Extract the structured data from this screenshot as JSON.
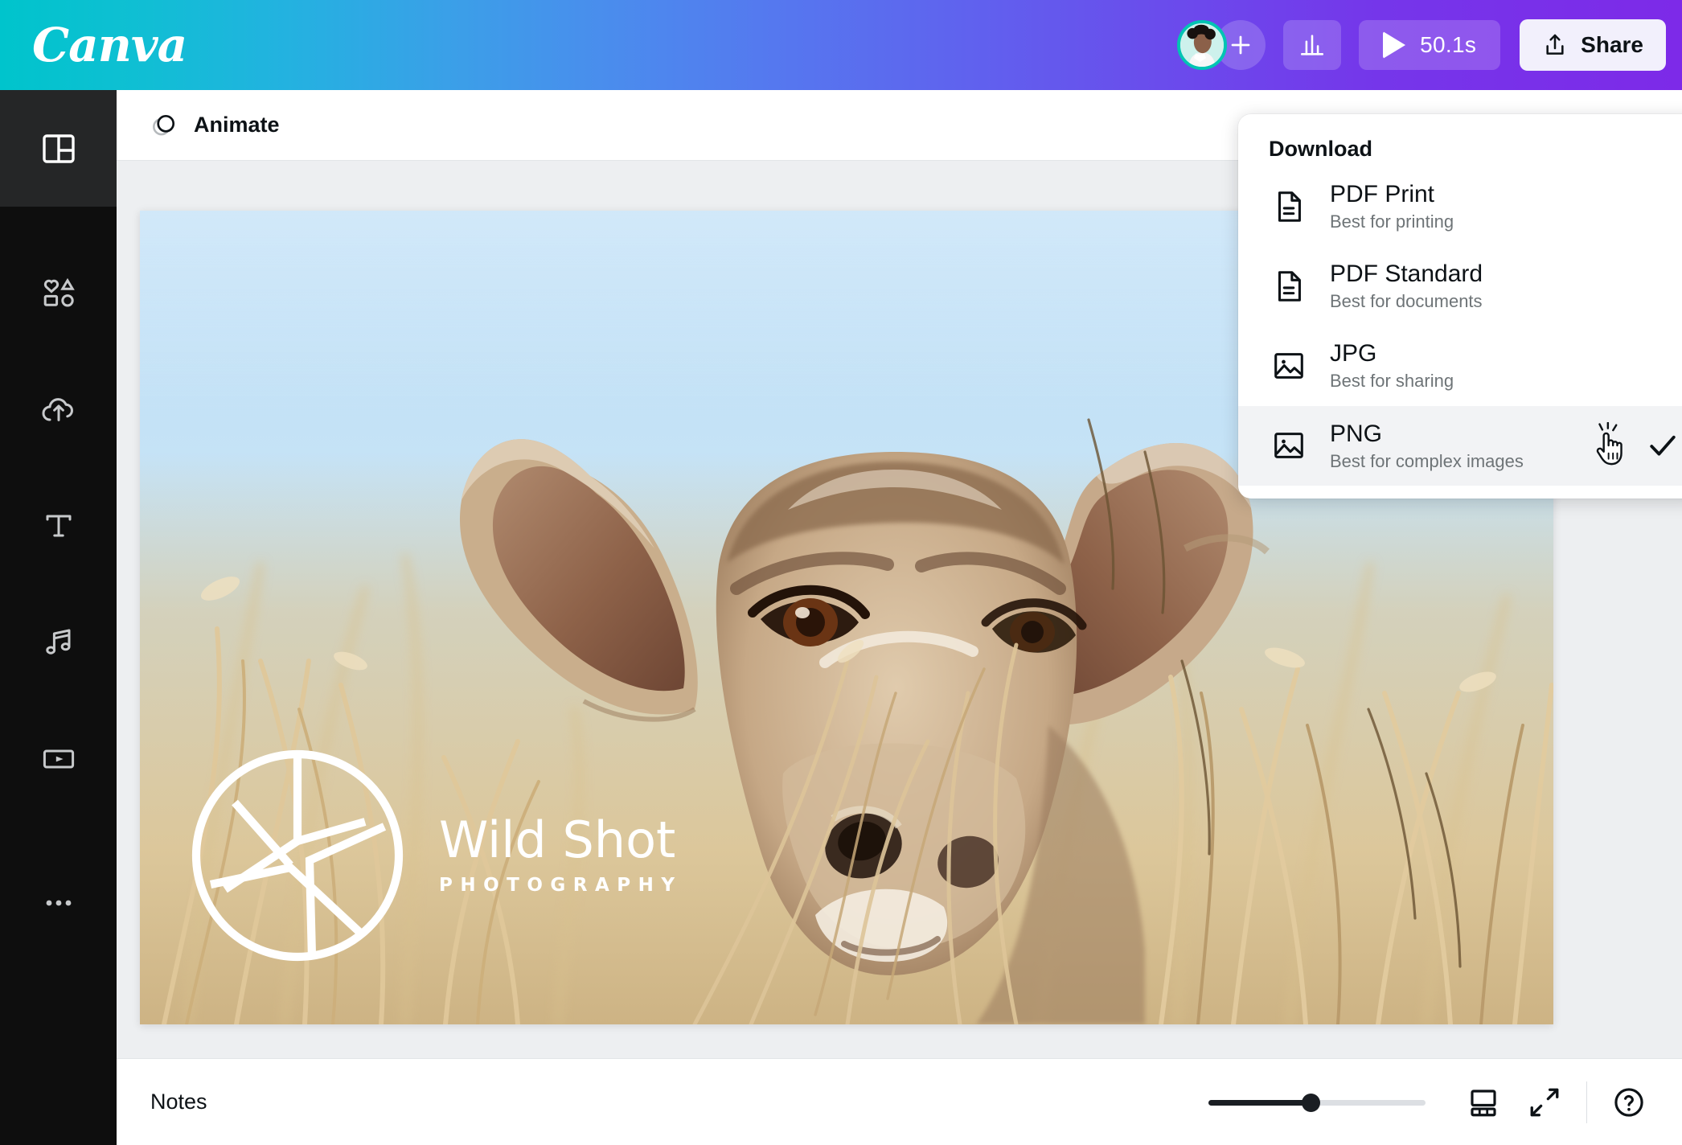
{
  "app": {
    "brand": "Canva",
    "brand_gradient_start": "#00c4cc",
    "brand_gradient_end": "#7d2ae8"
  },
  "topbar": {
    "avatar_name": "user-avatar",
    "avatar_ring_color": "#00c4b3",
    "add_collaborator_label": "+",
    "insights_icon": "bar-chart-icon",
    "play_label": "50.1s",
    "share_label": "Share"
  },
  "sidebar": {
    "items": [
      {
        "name": "design",
        "icon": "layout-panels-icon",
        "active": true
      },
      {
        "name": "elements",
        "icon": "shapes-icon",
        "active": false
      },
      {
        "name": "uploads",
        "icon": "cloud-upload-icon",
        "active": false
      },
      {
        "name": "text",
        "icon": "text-t-icon",
        "active": false
      },
      {
        "name": "audio",
        "icon": "music-note-icon",
        "active": false
      },
      {
        "name": "videos",
        "icon": "video-play-icon",
        "active": false
      },
      {
        "name": "more",
        "icon": "ellipsis-icon",
        "active": false
      }
    ]
  },
  "toolbar": {
    "animate_label": "Animate",
    "animate_icon": "overlapping-circles-icon"
  },
  "canvas": {
    "page_background": "#c5e2f7",
    "watermark": {
      "title": "Wild Shot",
      "subtitle": "PHOTOGRAPHY",
      "mark": "camera-aperture-icon"
    }
  },
  "download_menu": {
    "title": "Download",
    "items": [
      {
        "label": "PDF Print",
        "desc": "Best for printing",
        "icon": "document-lines-icon",
        "hovered": false,
        "checked": false
      },
      {
        "label": "PDF Standard",
        "desc": "Best for documents",
        "icon": "document-lines-icon",
        "hovered": false,
        "checked": false
      },
      {
        "label": "JPG",
        "desc": "Best for sharing",
        "icon": "image-picture-icon",
        "hovered": false,
        "checked": false
      },
      {
        "label": "PNG",
        "desc": "Best for complex images",
        "icon": "image-picture-icon",
        "hovered": true,
        "checked": true
      }
    ]
  },
  "bottombar": {
    "notes_label": "Notes",
    "zoom_percent": 47,
    "grid_icon": "page-thumbnails-icon",
    "fullscreen_icon": "expand-arrows-icon",
    "help_icon": "question-circle-icon"
  }
}
